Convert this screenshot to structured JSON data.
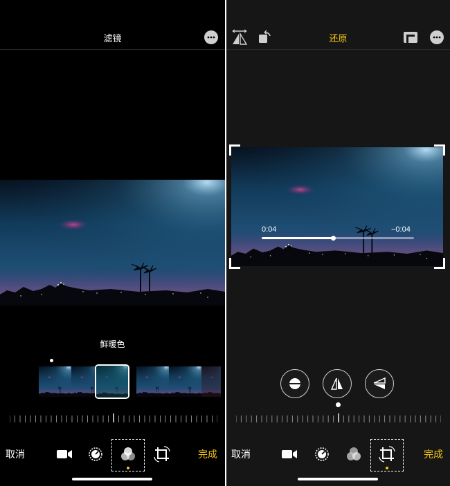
{
  "left_panel": {
    "title": "滤镜",
    "more_icon": "ellipsis-circle-icon",
    "filter_name": "鲜暖色",
    "thumbnail_count": 6,
    "selected_thumbnail_index": 2,
    "bottom": {
      "cancel_label": "取消",
      "done_label": "完成",
      "icons": [
        "video-camera-icon",
        "adjust-dial-icon",
        "filters-icon",
        "crop-rotate-icon"
      ],
      "selected_tool": "filters-icon"
    }
  },
  "right_panel": {
    "title": "还原",
    "flip_icon": "flip-horizontal-icon",
    "rotate_icon": "rotate-icon",
    "aspect_icon": "aspect-ratio-icon",
    "more_icon": "ellipsis-circle-icon",
    "video": {
      "elapsed": "0:04",
      "remaining": "−0:04",
      "progress": 0.47
    },
    "tools": [
      "straighten-icon",
      "vertical-perspective-icon",
      "horizontal-perspective-icon"
    ],
    "bottom": {
      "cancel_label": "取消",
      "done_label": "完成",
      "icons": [
        "video-camera-icon",
        "adjust-dial-icon",
        "filters-icon",
        "crop-rotate-icon"
      ],
      "selected_tool": "crop-rotate-icon"
    }
  },
  "colors": {
    "accent": "#f5c518",
    "background_left": "#000000",
    "background_right": "#161616"
  }
}
